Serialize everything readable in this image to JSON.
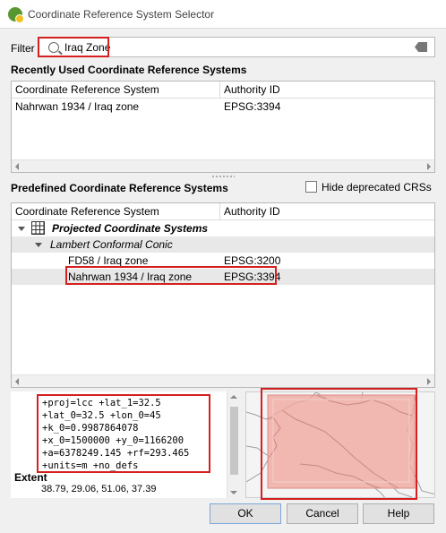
{
  "window": {
    "title": "Coordinate Reference System Selector"
  },
  "filter": {
    "label": "Filter",
    "value": "Iraq Zone"
  },
  "recent": {
    "section_title": "Recently Used Coordinate Reference Systems",
    "columns": [
      "Coordinate Reference System",
      "Authority ID"
    ],
    "rows": [
      {
        "crs": "Nahrwan 1934 / Iraq zone",
        "authority": "EPSG:3394"
      }
    ]
  },
  "predefined": {
    "section_title": "Predefined Coordinate Reference Systems",
    "hide_deprecated_label": "Hide deprecated CRSs",
    "hide_deprecated_checked": false,
    "columns": [
      "Coordinate Reference System",
      "Authority ID"
    ],
    "group": "Projected Coordinate Systems",
    "subgroup": "Lambert Conformal Conic",
    "rows": [
      {
        "crs": "FD58 / Iraq zone",
        "authority": "EPSG:3200"
      },
      {
        "crs": "Nahrwan 1934 / Iraq zone",
        "authority": "EPSG:3394"
      }
    ]
  },
  "details": {
    "proj_lines": [
      "+proj=lcc +lat_1=32.5",
      "+lat_0=32.5 +lon_0=45",
      "+k_0=0.9987864078",
      "+x_0=1500000 +y_0=1166200",
      "+a=6378249.145 +rf=293.465",
      "+units=m +no_defs"
    ],
    "extent_label": "Extent",
    "extent_value": "38.79, 29.06, 51.06, 37.39"
  },
  "buttons": {
    "ok": "OK",
    "cancel": "Cancel",
    "help": "Help"
  },
  "colors": {
    "highlight": "#d42020",
    "extent_fill": "#f0a8a0"
  }
}
